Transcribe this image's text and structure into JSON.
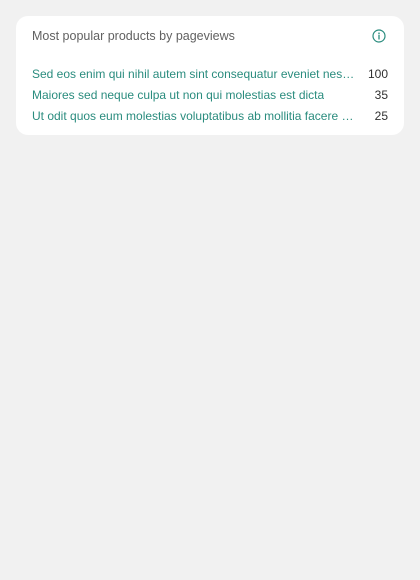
{
  "widget": {
    "title": "Most popular products by pageviews",
    "info_icon": "info-circle-icon",
    "accent_color": "#2a8c7e",
    "rows": [
      {
        "label": "Sed eos enim qui nihil autem sint consequatur eveniet nes…",
        "value": "100"
      },
      {
        "label": "Maiores sed neque culpa ut non qui molestias est dicta",
        "value": "35"
      },
      {
        "label": "Ut odit quos eum molestias voluptatibus ab mollitia facere …",
        "value": "25"
      }
    ]
  }
}
